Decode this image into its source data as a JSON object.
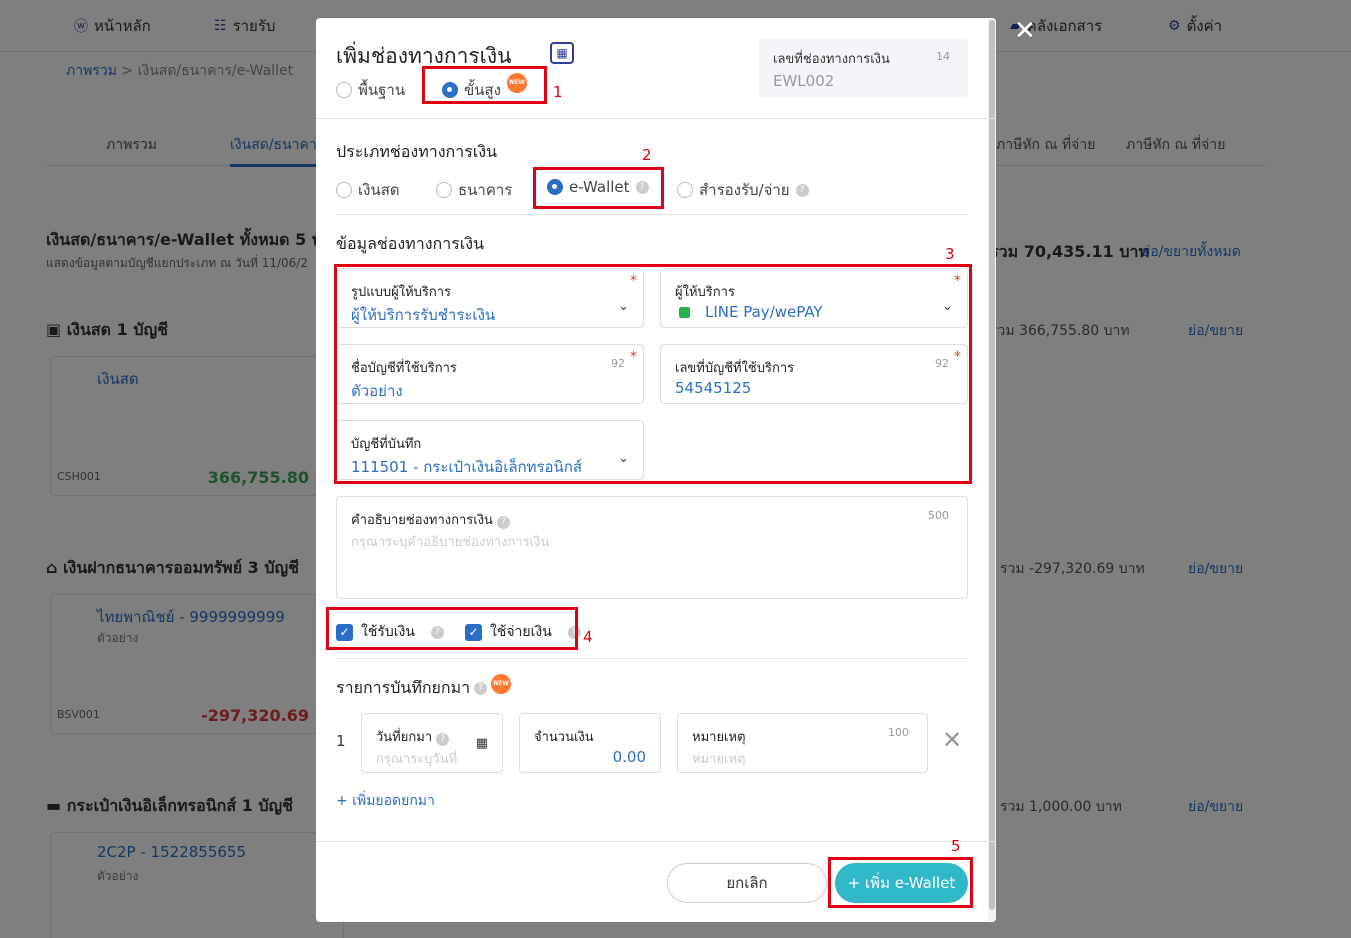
{
  "nav": [
    {
      "icon": "ⓦ",
      "label": "หน้าหลัก"
    },
    {
      "icon": "☷",
      "label": "รายรับ"
    },
    {
      "icon": "▰",
      "label": "คลังเอกสาร"
    },
    {
      "icon": "⚙",
      "label": "ตั้งค่า"
    }
  ],
  "breadcrumb": {
    "root": "ภาพรวม",
    "sep": ">",
    "current": "เงินสด/ธนาคาร/e-Wallet"
  },
  "tabs": [
    "ภาพรวม",
    "เงินสด/ธนาคาร",
    "ภาษีหัก ณ ที่จ่าย",
    "ภาษีหัก ณ ที่จ่าย"
  ],
  "summary": {
    "title": "เงินสด/ธนาคาร/e-Wallet ทั้งหมด 5 บัญชี",
    "subtitle": "แสดงข้อมูลตามบัญชีแยกประเภท ณ วันที่ 11/06/2",
    "total": "รวม 70,435.11 บาท",
    "collapse_all": "ย่อ/ขยายทั้งหมด"
  },
  "groups": [
    {
      "title": "เงินสด",
      "count": "1 บัญชี",
      "total": "รวม 366,755.80 บาท",
      "toggle": "ย่อ/ขยาย",
      "card": {
        "name": "เงินสด",
        "desc": "",
        "code": "CSH001",
        "amount": "366,755.80",
        "amount_color": "#3aa657"
      }
    },
    {
      "title": "เงินฝากธนาคารออมทรัพย์",
      "count": "3 บัญชี",
      "total": "รวม -297,320.69 บาท",
      "toggle": "ย่อ/ขยาย",
      "card": {
        "name": "ไทยพาณิชย์ - 9999999999",
        "desc": "ตัวอย่าง",
        "code": "BSV001",
        "amount": "-297,320.69",
        "amount_color": "#d9363e"
      }
    },
    {
      "title": "กระเป๋าเงินอิเล็กทรอนิกส์",
      "count": "1 บัญชี",
      "total": "รวม 1,000.00 บาท",
      "toggle": "ย่อ/ขยาย",
      "card": {
        "name": "2C2P - 1522855655",
        "desc": "ตัวอย่าง",
        "code": "",
        "amount": "",
        "amount_color": "#333"
      }
    }
  ],
  "modal": {
    "title": "เพิ่มช่องทางการเงิน",
    "mode_basic": "พื้นฐาน",
    "mode_advanced": "ขั้นสูง",
    "new_badge": "NEW",
    "doc_label": "เลขที่ช่องทางการเงิน",
    "doc_count": "14",
    "doc_value": "EWL002",
    "type_heading": "ประเภทช่องทางการเงิน",
    "types": [
      "เงินสด",
      "ธนาคาร",
      "e-Wallet",
      "สำรองรับ/จ่าย"
    ],
    "info_heading": "ข้อมูลช่องทางการเงิน",
    "provider_type_label": "รูปแบบผู้ให้บริการ",
    "provider_type_value": "ผู้ให้บริการรับชำระเงิน",
    "provider_label": "ผู้ให้บริการ",
    "provider_value": "LINE Pay/wePAY",
    "account_name_label": "ชื่อบัญชีที่ใช้บริการ",
    "account_name_count": "92",
    "account_name_value": "ตัวอย่าง",
    "account_no_label": "เลขที่บัญชีที่ใช้บริการ",
    "account_no_count": "92",
    "account_no_value": "54545125",
    "ledger_label": "บัญชีที่บันทึก",
    "ledger_value": "111501 - กระเป๋าเงินอิเล็กทรอนิกส์",
    "desc_label": "คำอธิบายช่องทางการเงิน",
    "desc_count": "500",
    "desc_placeholder": "กรุณาระบุคำอธิบายช่องทางการเงิน",
    "use_receive": "ใช้รับเงิน",
    "use_pay": "ใช้จ่ายเงิน",
    "carry_heading": "รายการบันทึกยกมา",
    "row_no": "1",
    "date_label": "วันที่ยกมา",
    "date_placeholder": "กรุณาระบุวันที่",
    "amount_label": "จำนวนเงิน",
    "amount_value": "0.00",
    "note_label": "หมายเหตุ",
    "note_count": "100",
    "note_placeholder": "หมายเหตุ",
    "add_more": "+ เพิ่มยอดยกมา",
    "cancel": "ยกเลิก",
    "submit": "+ เพิ่ม e-Wallet"
  },
  "annotations": [
    "1",
    "2",
    "3",
    "4",
    "5"
  ],
  "colors": {
    "accent": "#2b6ec8",
    "teal": "#2fb8c8",
    "annotation": "#e00012"
  }
}
